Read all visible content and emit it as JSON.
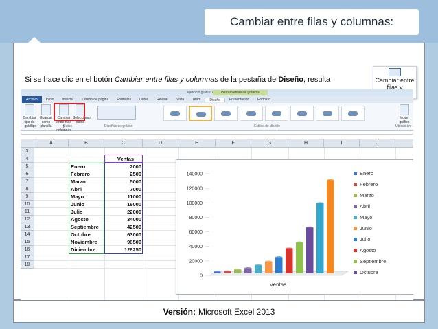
{
  "slide": {
    "title": "Cambiar entre filas y columnas:",
    "desc_prefix": "Si se hace clic en el botón ",
    "desc_italic": "Cambiar entre filas y columnas",
    "desc_mid": " de la pestaña de ",
    "desc_bold": "Diseño",
    "desc_suffix": ", resulta",
    "callout_label": "Cambiar entre filas y columnas",
    "version_label": "Versión:",
    "version_value": "Microsoft Excel 2013"
  },
  "excel": {
    "window_title": "ejercicio grafico excel - Microsoft Excel",
    "context_tab": "Herramientas de gráficos",
    "tabs": [
      "Archivo",
      "Inicio",
      "Insertar",
      "Diseño de página",
      "Fórmulas",
      "Datos",
      "Revisar",
      "Vista",
      "Team",
      "Diseño",
      "Presentación",
      "Formato"
    ],
    "ribbon": {
      "change_type": "Cambiar tipo de gráfico",
      "save_template": "Guardar como plantilla",
      "switch": "Cambiar entre filas y columnas",
      "select_data": "Seleccionar datos",
      "move_chart": "Mover gráfico",
      "group_tipo": "Tipo",
      "group_datos": "Datos",
      "group_diseno": "Diseños de gráfico",
      "group_estilos": "Estilos de diseño",
      "group_ubicacion": "Ubicación"
    },
    "columns": [
      "A",
      "B",
      "C",
      "D",
      "E",
      "F",
      "G",
      "H",
      "I",
      "J"
    ],
    "rows": [
      "3",
      "4",
      "5",
      "6",
      "7",
      "8",
      "9",
      "10",
      "11",
      "12",
      "13",
      "14",
      "15",
      "16",
      "17",
      "18"
    ],
    "header_ventas": "Ventas",
    "months": [
      "Enero",
      "Febrero",
      "Marzo",
      "Abril",
      "Mayo",
      "Junio",
      "Julio",
      "Agosto",
      "Septiembre",
      "Octubre",
      "Noviembre",
      "Diciembre"
    ],
    "sales": [
      "2000",
      "2500",
      "5000",
      "7000",
      "11000",
      "16000",
      "22000",
      "34000",
      "42500",
      "63000",
      "96500",
      "128250"
    ]
  },
  "chart_data": {
    "type": "bar",
    "xlabel": "Ventas",
    "ylim": [
      0,
      140000
    ],
    "yticks": [
      "140000",
      "120000",
      "100000",
      "80000",
      "60000",
      "40000",
      "20000",
      "0"
    ],
    "series": [
      {
        "name": "Enero",
        "value": 2000,
        "color": "#4472c4"
      },
      {
        "name": "Febrero",
        "value": 2500,
        "color": "#c0504d"
      },
      {
        "name": "Marzo",
        "value": 5000,
        "color": "#9bbb59"
      },
      {
        "name": "Abril",
        "value": 7000,
        "color": "#8064a2"
      },
      {
        "name": "Mayo",
        "value": 11000,
        "color": "#4bacc6"
      },
      {
        "name": "Junio",
        "value": 16000,
        "color": "#f79646"
      },
      {
        "name": "Julio",
        "value": 22000,
        "color": "#2c7fd0"
      },
      {
        "name": "Agosto",
        "value": 34000,
        "color": "#d9342b"
      },
      {
        "name": "Septiembre",
        "value": 42500,
        "color": "#8fc24a"
      },
      {
        "name": "Octubre",
        "value": 63000,
        "color": "#6a4c9c"
      },
      {
        "name": "Noviembre",
        "value": 96500,
        "color": "#33a6cc"
      },
      {
        "name": "Diciembre",
        "value": 128250,
        "color": "#f5891f"
      }
    ],
    "legend_visible": [
      "Enero",
      "Febrero",
      "Marzo",
      "Abril",
      "Mayo",
      "Junio",
      "Julio",
      "Agosto",
      "Septiembre",
      "Octubre"
    ]
  }
}
